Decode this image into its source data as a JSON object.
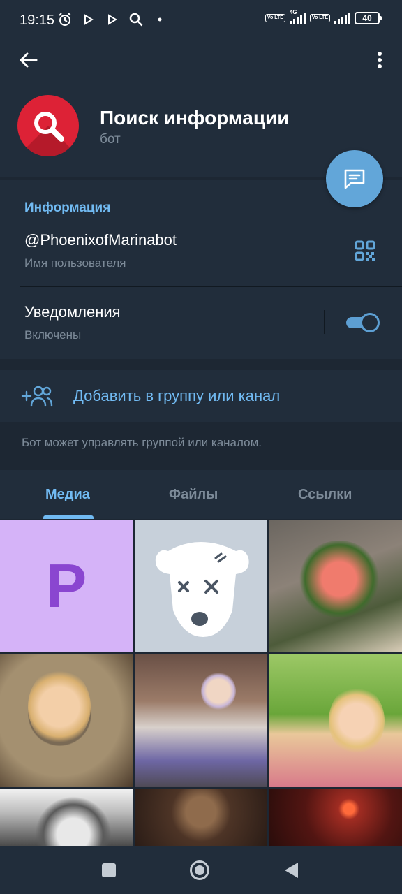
{
  "status_bar": {
    "time": "19:15",
    "net_label": "4G",
    "volte_1": "Vo LTE",
    "volte_2": "Vo LTE",
    "battery": "40"
  },
  "header": {
    "title": "Поиск информации",
    "subtitle": "бот",
    "back_icon": "arrow-back-icon",
    "menu_icon": "more-vert-icon",
    "avatar_icon": "search-icon"
  },
  "info": {
    "section_title": "Информация",
    "username": "@PhoenixofMarinabot",
    "username_label": "Имя пользователя",
    "notifications_title": "Уведомления",
    "notifications_state": "Включены",
    "notifications_enabled": true
  },
  "add_group": {
    "label": "Добавить в группу или канал",
    "hint": "Бот может управлять группой или каналом."
  },
  "tabs": [
    {
      "label": "Медиа",
      "active": true
    },
    {
      "label": "Файлы",
      "active": false
    },
    {
      "label": "Ссылки",
      "active": false
    }
  ],
  "media": {
    "first_tile_letter": "P"
  },
  "colors": {
    "background": "#1d2733",
    "panel": "#212d3b",
    "accent": "#71baf2",
    "fab": "#62a6d9",
    "secondary_text": "#7d8b99",
    "avatar": "#dd2236"
  }
}
